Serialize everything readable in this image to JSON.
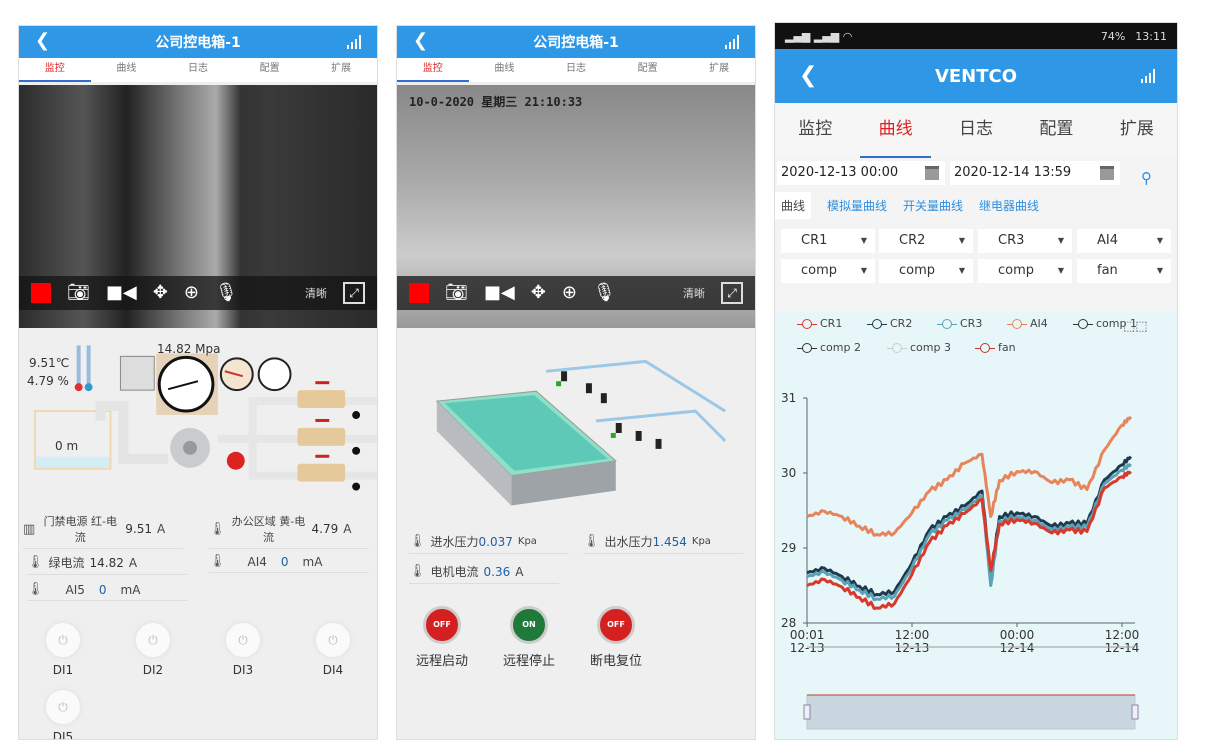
{
  "phone1": {
    "title": "公司控电箱-1",
    "tabs": [
      "监控",
      "曲线",
      "日志",
      "配置",
      "扩展"
    ],
    "active_tab": 0,
    "video": {
      "quality_label": "清晰"
    },
    "diagram": {
      "temperature": "9.51℃",
      "humidity": "4.79 %",
      "pressure": "14.82 Mpa",
      "level": "0 m"
    },
    "readings": [
      {
        "label": "门禁电源 红-电流",
        "value": "9.51",
        "unit": "A"
      },
      {
        "label": "办公区域 黄-电流",
        "value": "4.79",
        "unit": "A"
      },
      {
        "label": "绿电流",
        "value": "14.82",
        "unit": "A"
      },
      {
        "label": "AI4",
        "value": "0",
        "unit": "mA"
      },
      {
        "label": "AI5",
        "value": "0",
        "unit": "mA"
      }
    ],
    "digital_inputs": [
      "DI1",
      "DI2",
      "DI3",
      "DI4",
      "DI5"
    ]
  },
  "phone2": {
    "title": "公司控电箱-1",
    "tabs": [
      "监控",
      "曲线",
      "日志",
      "配置",
      "扩展"
    ],
    "active_tab": 0,
    "video": {
      "timestamp": "10-0-2020 星期三 21:10:33",
      "quality_label": "清晰"
    },
    "readings": [
      {
        "label": "进水压力",
        "value": "0.037",
        "unit": "Kpa"
      },
      {
        "label": "出水压力",
        "value": "1.454",
        "unit": "Kpa"
      },
      {
        "label": "电机电流",
        "value": "0.36",
        "unit": "A"
      }
    ],
    "controls": [
      {
        "label": "远程启动",
        "state": "OFF",
        "color": "#d42020"
      },
      {
        "label": "远程停止",
        "state": "ON",
        "color": "#1f7a3a"
      },
      {
        "label": "断电复位",
        "state": "OFF",
        "color": "#d42020"
      }
    ]
  },
  "phone3": {
    "status_bar": {
      "battery": "74%",
      "time": "13:11"
    },
    "title": "VENTCO",
    "tabs": [
      "监控",
      "曲线",
      "日志",
      "配置",
      "扩展"
    ],
    "active_tab": 1,
    "start_date": "2020-12-13 00:00",
    "end_date": "2020-12-14 13:59",
    "subtabs": [
      "曲线",
      "模拟量曲线",
      "开关量曲线",
      "继电器曲线"
    ],
    "selects": [
      "CR1",
      "CR2",
      "CR3",
      "AI4",
      "comp",
      "comp",
      "comp",
      "fan"
    ]
  },
  "chart_data": {
    "type": "line",
    "ylim": [
      28,
      31
    ],
    "yticks": [
      "28",
      "29",
      "30",
      "31"
    ],
    "xticks": [
      {
        "time": "12-13 00:01",
        "line1": "00:01",
        "line2": "12-13"
      },
      {
        "time": "12-13 12:00",
        "line1": "12:00",
        "line2": "12-13"
      },
      {
        "time": "12-14 00:00",
        "line1": "00:00",
        "line2": "12-14"
      },
      {
        "time": "12-14 12:00",
        "line1": "12:00",
        "line2": "12-14"
      }
    ],
    "legend": [
      {
        "name": "CR1",
        "color": "#d9382c"
      },
      {
        "name": "CR2",
        "color": "#1f3a4d"
      },
      {
        "name": "CR3",
        "color": "#5aa3b5"
      },
      {
        "name": "AI4",
        "color": "#e8845a"
      },
      {
        "name": "comp 1",
        "color": "#333333"
      },
      {
        "name": "comp 2",
        "color": "#333333"
      },
      {
        "name": "comp 3",
        "color": "#cccccc"
      },
      {
        "name": "fan",
        "color": "#c0392b"
      }
    ],
    "x": [
      "12-13 00:00",
      "12-13 02:00",
      "12-13 04:00",
      "12-13 06:00",
      "12-13 08:00",
      "12-13 10:00",
      "12-13 12:00",
      "12-13 14:00",
      "12-13 16:00",
      "12-13 18:00",
      "12-13 20:00",
      "12-13 21:00",
      "12-13 22:00",
      "12-14 00:00",
      "12-14 02:00",
      "12-14 04:00",
      "12-14 06:00",
      "12-14 08:00",
      "12-14 10:00",
      "12-14 12:00",
      "12-14 13:00"
    ],
    "series": [
      {
        "name": "AI4",
        "color": "#e8845a",
        "values": [
          29.42,
          29.49,
          29.42,
          29.29,
          29.18,
          29.2,
          29.47,
          29.76,
          29.91,
          30.13,
          30.25,
          29.42,
          29.9,
          30.02,
          30.02,
          29.87,
          29.91,
          29.78,
          30.31,
          30.64,
          30.75
        ]
      },
      {
        "name": "CR2",
        "color": "#1f3a4d",
        "values": [
          28.67,
          28.73,
          28.62,
          28.49,
          28.38,
          28.42,
          28.8,
          29.24,
          29.42,
          29.56,
          29.76,
          28.62,
          29.42,
          29.47,
          29.42,
          29.29,
          29.33,
          29.33,
          29.91,
          30.11,
          30.22
        ]
      },
      {
        "name": "CR3",
        "color": "#5aa3b5",
        "values": [
          28.62,
          28.68,
          28.57,
          28.44,
          28.32,
          28.36,
          28.74,
          29.18,
          29.37,
          29.51,
          29.7,
          28.5,
          29.36,
          29.42,
          29.37,
          29.24,
          29.28,
          29.28,
          29.86,
          30.04,
          30.12
        ]
      },
      {
        "name": "CR1",
        "color": "#d9382c",
        "values": [
          28.5,
          28.58,
          28.48,
          28.34,
          28.2,
          28.26,
          28.65,
          29.08,
          29.3,
          29.46,
          29.65,
          28.7,
          29.32,
          29.38,
          29.33,
          29.2,
          29.24,
          29.22,
          29.8,
          29.95,
          30.02
        ]
      }
    ]
  }
}
